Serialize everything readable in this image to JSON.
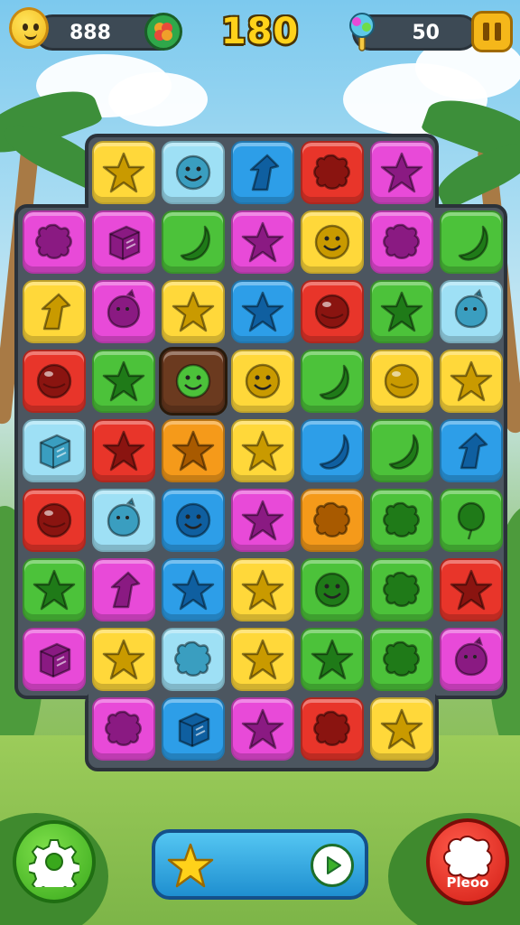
{
  "hud": {
    "coins": "888",
    "score": "180",
    "moves": "50"
  },
  "colors": {
    "yellow": "#ffd83a",
    "blue": "#2d9ee8",
    "lightblue": "#9ee0f5",
    "red": "#e8352a",
    "magenta": "#e84ad8",
    "green": "#4cc23a",
    "orange": "#f59a1a",
    "brown": "#6b3a1f"
  },
  "board": {
    "rows": [
      [
        "",
        "yellow-star",
        "lightblue-smile",
        "blue-arrow",
        "red-splat",
        "magenta-star",
        ""
      ],
      [
        "magenta-splat",
        "magenta-cube",
        "green-banana",
        "magenta-star",
        "yellow-smile",
        "magenta-splat",
        "green-banana"
      ],
      [
        "yellow-arrow",
        "magenta-blob",
        "yellow-star",
        "blue-star",
        "red-ball",
        "green-star",
        "lightblue-blob"
      ],
      [
        "red-ball",
        "green-star",
        "brown-smile",
        "yellow-smile",
        "green-banana",
        "yellow-ball",
        "yellow-star"
      ],
      [
        "lightblue-cube",
        "red-star",
        "orange-star",
        "yellow-star",
        "blue-banana",
        "green-banana",
        "blue-arrow"
      ],
      [
        "red-ball",
        "lightblue-blob",
        "blue-smile",
        "magenta-star",
        "orange-splat",
        "green-splat",
        "green-balloon"
      ],
      [
        "green-star",
        "magenta-arrow",
        "blue-star",
        "yellow-star",
        "green-smile",
        "green-splat",
        "red-star"
      ],
      [
        "magenta-cube",
        "yellow-star",
        "lightblue-splat",
        "yellow-star",
        "green-star",
        "green-splat",
        "magenta-blob"
      ],
      [
        "",
        "magenta-splat",
        "blue-cube",
        "magenta-star",
        "red-splat",
        "yellow-star",
        ""
      ]
    ]
  },
  "controls": {
    "red_button_label": "Pleoo"
  }
}
